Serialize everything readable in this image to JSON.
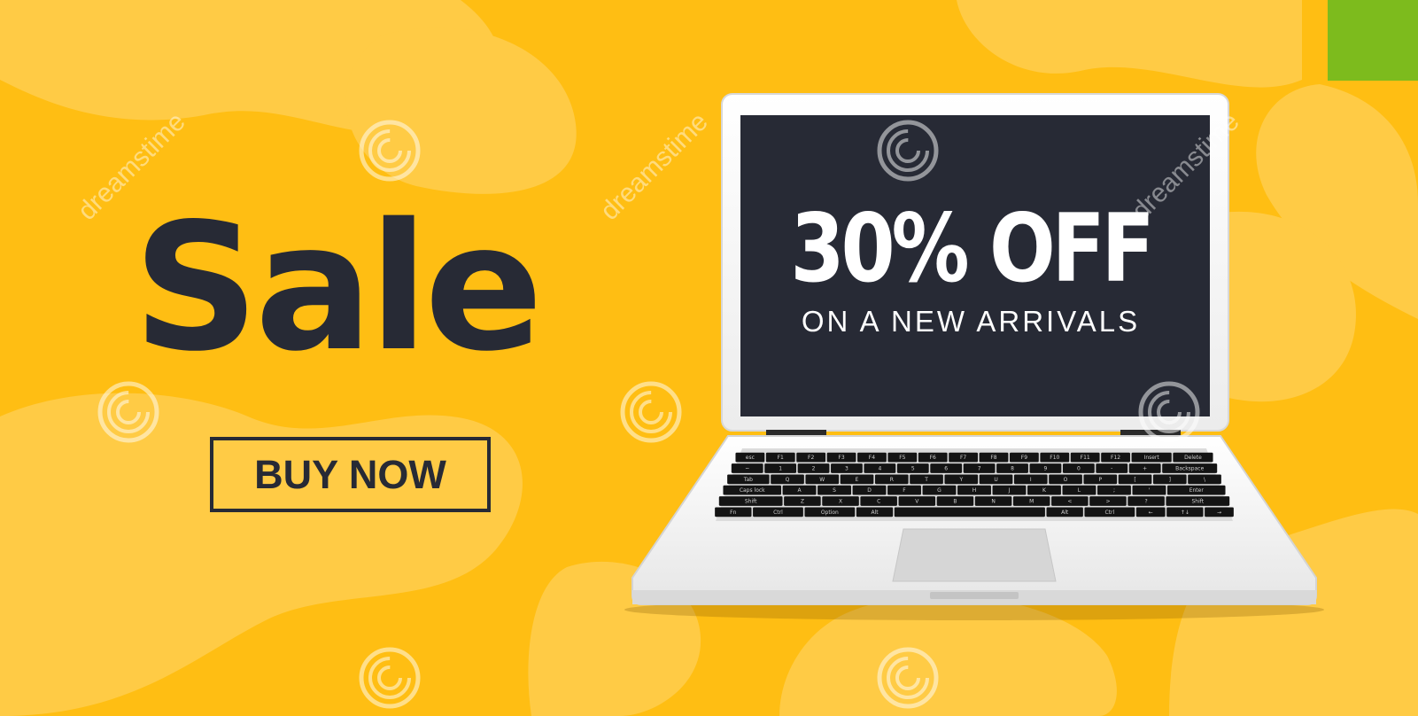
{
  "banner": {
    "heading": "Sale",
    "button_label": "BUY NOW",
    "screen": {
      "discount": "30% OFF",
      "subtitle": "ON A NEW ARRIVALS"
    },
    "watermark_text": "dreamstime"
  },
  "keyboard": {
    "rows": [
      [
        "esc",
        "F1",
        "F2",
        "F3",
        "F4",
        "F5",
        "F6",
        "F7",
        "F8",
        "F9",
        "F10",
        "F11",
        "F12",
        "Insert",
        "Delete"
      ],
      [
        "~",
        "1",
        "2",
        "3",
        "4",
        "5",
        "6",
        "7",
        "8",
        "9",
        "0",
        "-",
        "+",
        "Backspace"
      ],
      [
        "Tab",
        "Q",
        "W",
        "E",
        "R",
        "T",
        "Y",
        "U",
        "I",
        "O",
        "P",
        "[",
        "]",
        "\\"
      ],
      [
        "Caps lock",
        "A",
        "S",
        "D",
        "F",
        "G",
        "H",
        "J",
        "K",
        "L",
        ";",
        "'",
        "Enter"
      ],
      [
        "Shift",
        "Z",
        "X",
        "C",
        "V",
        "B",
        "N",
        "M",
        "<",
        ">",
        "?",
        "Shift"
      ],
      [
        "Fn",
        "Ctrl",
        "Option",
        "Alt",
        "",
        "Alt",
        "Ctrl",
        "←",
        "↑↓",
        "→"
      ]
    ]
  },
  "colors": {
    "background": "#FFBE13",
    "background_light": "#FFCB45",
    "dark": "#272A35",
    "screen": "#272A35",
    "accent_corner": "#7DBB1D",
    "laptop_body": "#F2F2F2",
    "trackpad": "#D6D6D6",
    "watermark": "#FFFFFF"
  }
}
